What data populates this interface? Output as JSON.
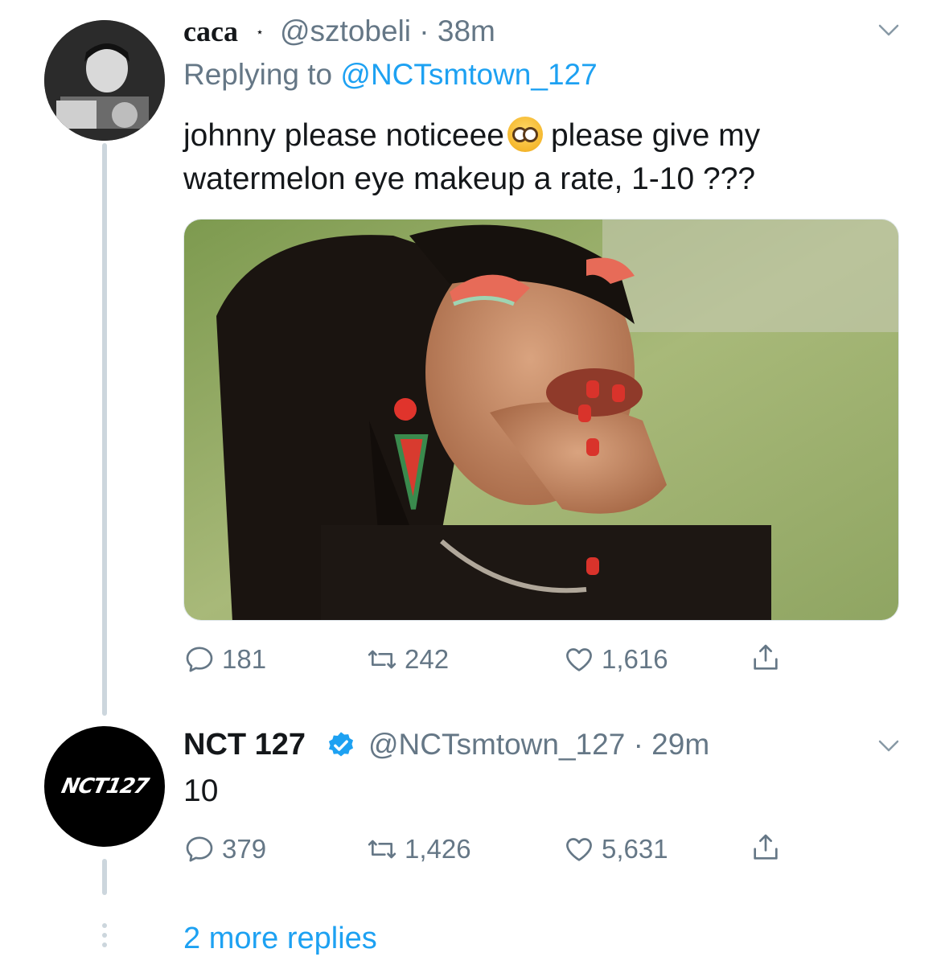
{
  "tweet1": {
    "display_name": "caca",
    "name_symbol": "⋆",
    "handle_time": "@sztobeli · 38m",
    "replying_label": "Replying to",
    "replying_mention": "@NCTsmtown_127",
    "text_part1": "johnny please noticeee",
    "text_part2": "please give my watermelon eye makeup a rate, 1-10 ???",
    "emoji_icon": "pleading-face-emoji",
    "replies": "181",
    "retweets": "242",
    "likes": "1,616"
  },
  "tweet2": {
    "display_name": "NCT 127",
    "avatar_logo": "NCT127",
    "handle_time": "@NCTsmtown_127 · 29m",
    "text": "10",
    "replies": "379",
    "retweets": "1,426",
    "likes": "5,631"
  },
  "more_replies": "2 more replies",
  "colors": {
    "accent": "#1da1f2",
    "secondary_text": "#657786",
    "primary_text": "#14171a",
    "thread_line": "#ccd6dd"
  }
}
